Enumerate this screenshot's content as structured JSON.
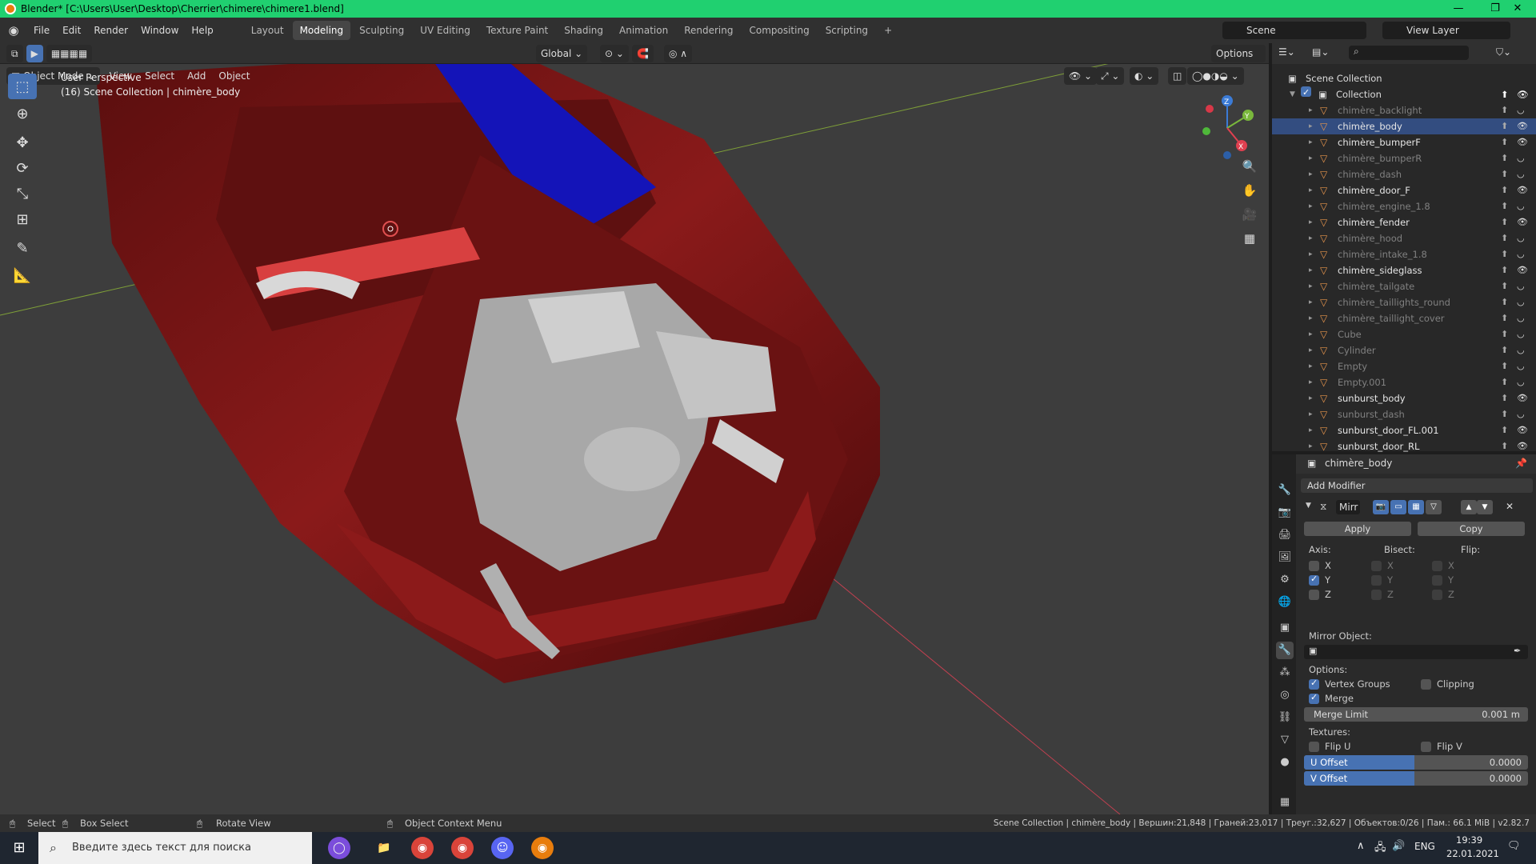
{
  "window": {
    "title": "Blender* [C:\\Users\\User\\Desktop\\Cherrier\\chimere\\chimere1.blend]",
    "min": "—",
    "max": "❐",
    "close": "✕"
  },
  "menubar": {
    "menus": [
      "File",
      "Edit",
      "Render",
      "Window",
      "Help"
    ],
    "workspaces": [
      "Layout",
      "Modeling",
      "Sculpting",
      "UV Editing",
      "Texture Paint",
      "Shading",
      "Animation",
      "Rendering",
      "Compositing",
      "Scripting"
    ],
    "add_tab": "+",
    "scene": "Scene",
    "view_layer": "View Layer"
  },
  "viewport": {
    "transform_orientation": "Global",
    "options": "Options",
    "mode": "Object Mode",
    "menus": [
      "View",
      "Select",
      "Add",
      "Object"
    ],
    "perspective": "User Perspective",
    "collection_info": "(16) Scene Collection | chimère_body",
    "gizmo_axes": {
      "x": "X",
      "y": "Y",
      "z": "Z"
    }
  },
  "outliner": {
    "search_placeholder": "",
    "scene_collection": "Scene Collection",
    "collection": "Collection",
    "items": [
      {
        "name": "chimère_backlight",
        "visible": false
      },
      {
        "name": "chimère_body",
        "visible": true
      },
      {
        "name": "chimère_bumperF",
        "visible": true
      },
      {
        "name": "chimère_bumperR",
        "visible": false
      },
      {
        "name": "chimère_dash",
        "visible": false
      },
      {
        "name": "chimère_door_F",
        "visible": true
      },
      {
        "name": "chimère_engine_1.8",
        "visible": false
      },
      {
        "name": "chimère_fender",
        "visible": true
      },
      {
        "name": "chimère_hood",
        "visible": false
      },
      {
        "name": "chimère_intake_1.8",
        "visible": false
      },
      {
        "name": "chimère_sideglass",
        "visible": true
      },
      {
        "name": "chimère_tailgate",
        "visible": false
      },
      {
        "name": "chimère_taillights_round",
        "visible": false
      },
      {
        "name": "chimère_taillight_cover",
        "visible": false
      },
      {
        "name": "Cube",
        "visible": false
      },
      {
        "name": "Cylinder",
        "visible": false
      },
      {
        "name": "Empty",
        "visible": false
      },
      {
        "name": "Empty.001",
        "visible": false
      },
      {
        "name": "sunburst_body",
        "visible": true
      },
      {
        "name": "sunburst_dash",
        "visible": false
      },
      {
        "name": "sunburst_door_FL.001",
        "visible": true
      },
      {
        "name": "sunburst_door_RL",
        "visible": true
      }
    ]
  },
  "properties": {
    "object_name": "chimère_body",
    "add_modifier": "Add Modifier",
    "modifier_name": "Mirr",
    "apply": "Apply",
    "copy": "Copy",
    "axis_label": "Axis:",
    "bisect_label": "Bisect:",
    "flip_label": "Flip:",
    "axes": [
      "X",
      "Y",
      "Z"
    ],
    "axis_checked": [
      false,
      true,
      false
    ],
    "mirror_object_label": "Mirror Object:",
    "options_label": "Options:",
    "vertex_groups": "Vertex Groups",
    "clipping": "Clipping",
    "merge": "Merge",
    "merge_limit_label": "Merge Limit",
    "merge_limit_value": "0.001 m",
    "textures_label": "Textures:",
    "flip_u": "Flip U",
    "flip_v": "Flip V",
    "u_offset_label": "U Offset",
    "u_offset_value": "0.0000",
    "v_offset_label": "V Offset",
    "v_offset_value": "0.0000"
  },
  "statusbar": {
    "select": "Select",
    "box_select": "Box Select",
    "rotate_view": "Rotate View",
    "context_menu": "Object Context Menu",
    "stats": "Scene Collection | chimère_body | Вершин:21,848 | Граней:23,017 | Треуг.:32,627 | Объектов:0/26 | Пам.: 66.1 MiB | v2.82.7"
  },
  "taskbar": {
    "search_placeholder": "Введите здесь текст для поиска",
    "lang": "ENG",
    "time": "19:39",
    "date": "22.01.2021"
  },
  "colors": {
    "accent": "#4772b3",
    "titlebar": "#20d070",
    "body_red": "#7a1414",
    "glass_blue": "#1010b0",
    "engine_gray": "#b8b8b8"
  }
}
